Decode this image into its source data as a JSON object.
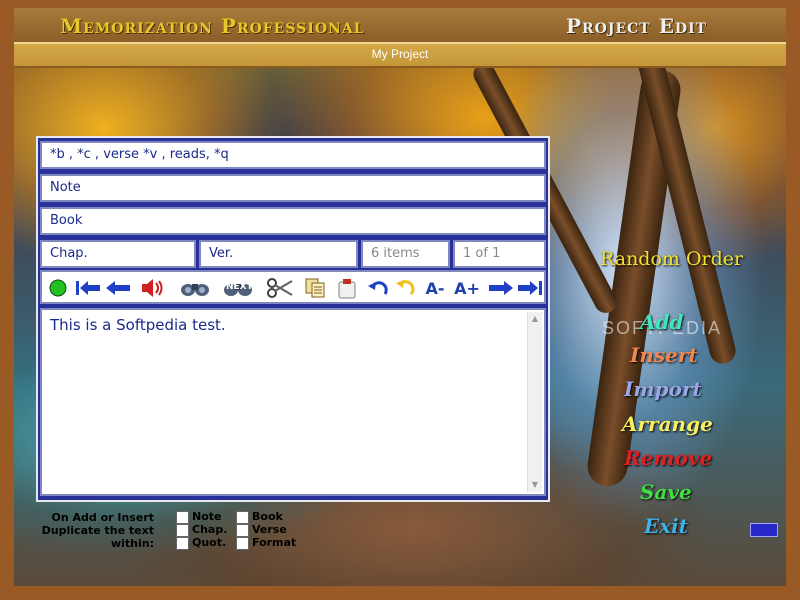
{
  "app_title": "Memorization Professional",
  "mode_title": "Project Edit",
  "project_name": "My Project",
  "fields": {
    "reference": "*b , *c , verse *v , reads, *q",
    "note": "Note",
    "book": "Book",
    "chapter": "Chap.",
    "verse": "Ver.",
    "item_count": "6 items",
    "position": "1 of 1"
  },
  "editor": {
    "text": "This is a Softpedia test."
  },
  "toolbar": {
    "font_smaller": "A-",
    "font_larger": "A+",
    "next_text": "NEXT"
  },
  "actions": {
    "random_order": "Random Order",
    "add": "Add",
    "insert": "Insert",
    "import": "Import",
    "arrange": "Arrange",
    "remove": "Remove",
    "save": "Save",
    "exit": "Exit"
  },
  "action_colors": {
    "add": "#40e8c0",
    "insert": "#f08850",
    "import": "#9aa8e8",
    "arrange": "#f8f060",
    "remove": "#e02020",
    "save": "#40e040",
    "exit": "#40b0e8"
  },
  "options": {
    "label_line1": "On Add or Insert",
    "label_line2": "Duplicate the text",
    "label_line3": "within:",
    "note": "Note",
    "chap": "Chap.",
    "quot": "Quot.",
    "book": "Book",
    "verse": "Verse",
    "format": "Format"
  },
  "watermark": "SOFTPEDIA"
}
